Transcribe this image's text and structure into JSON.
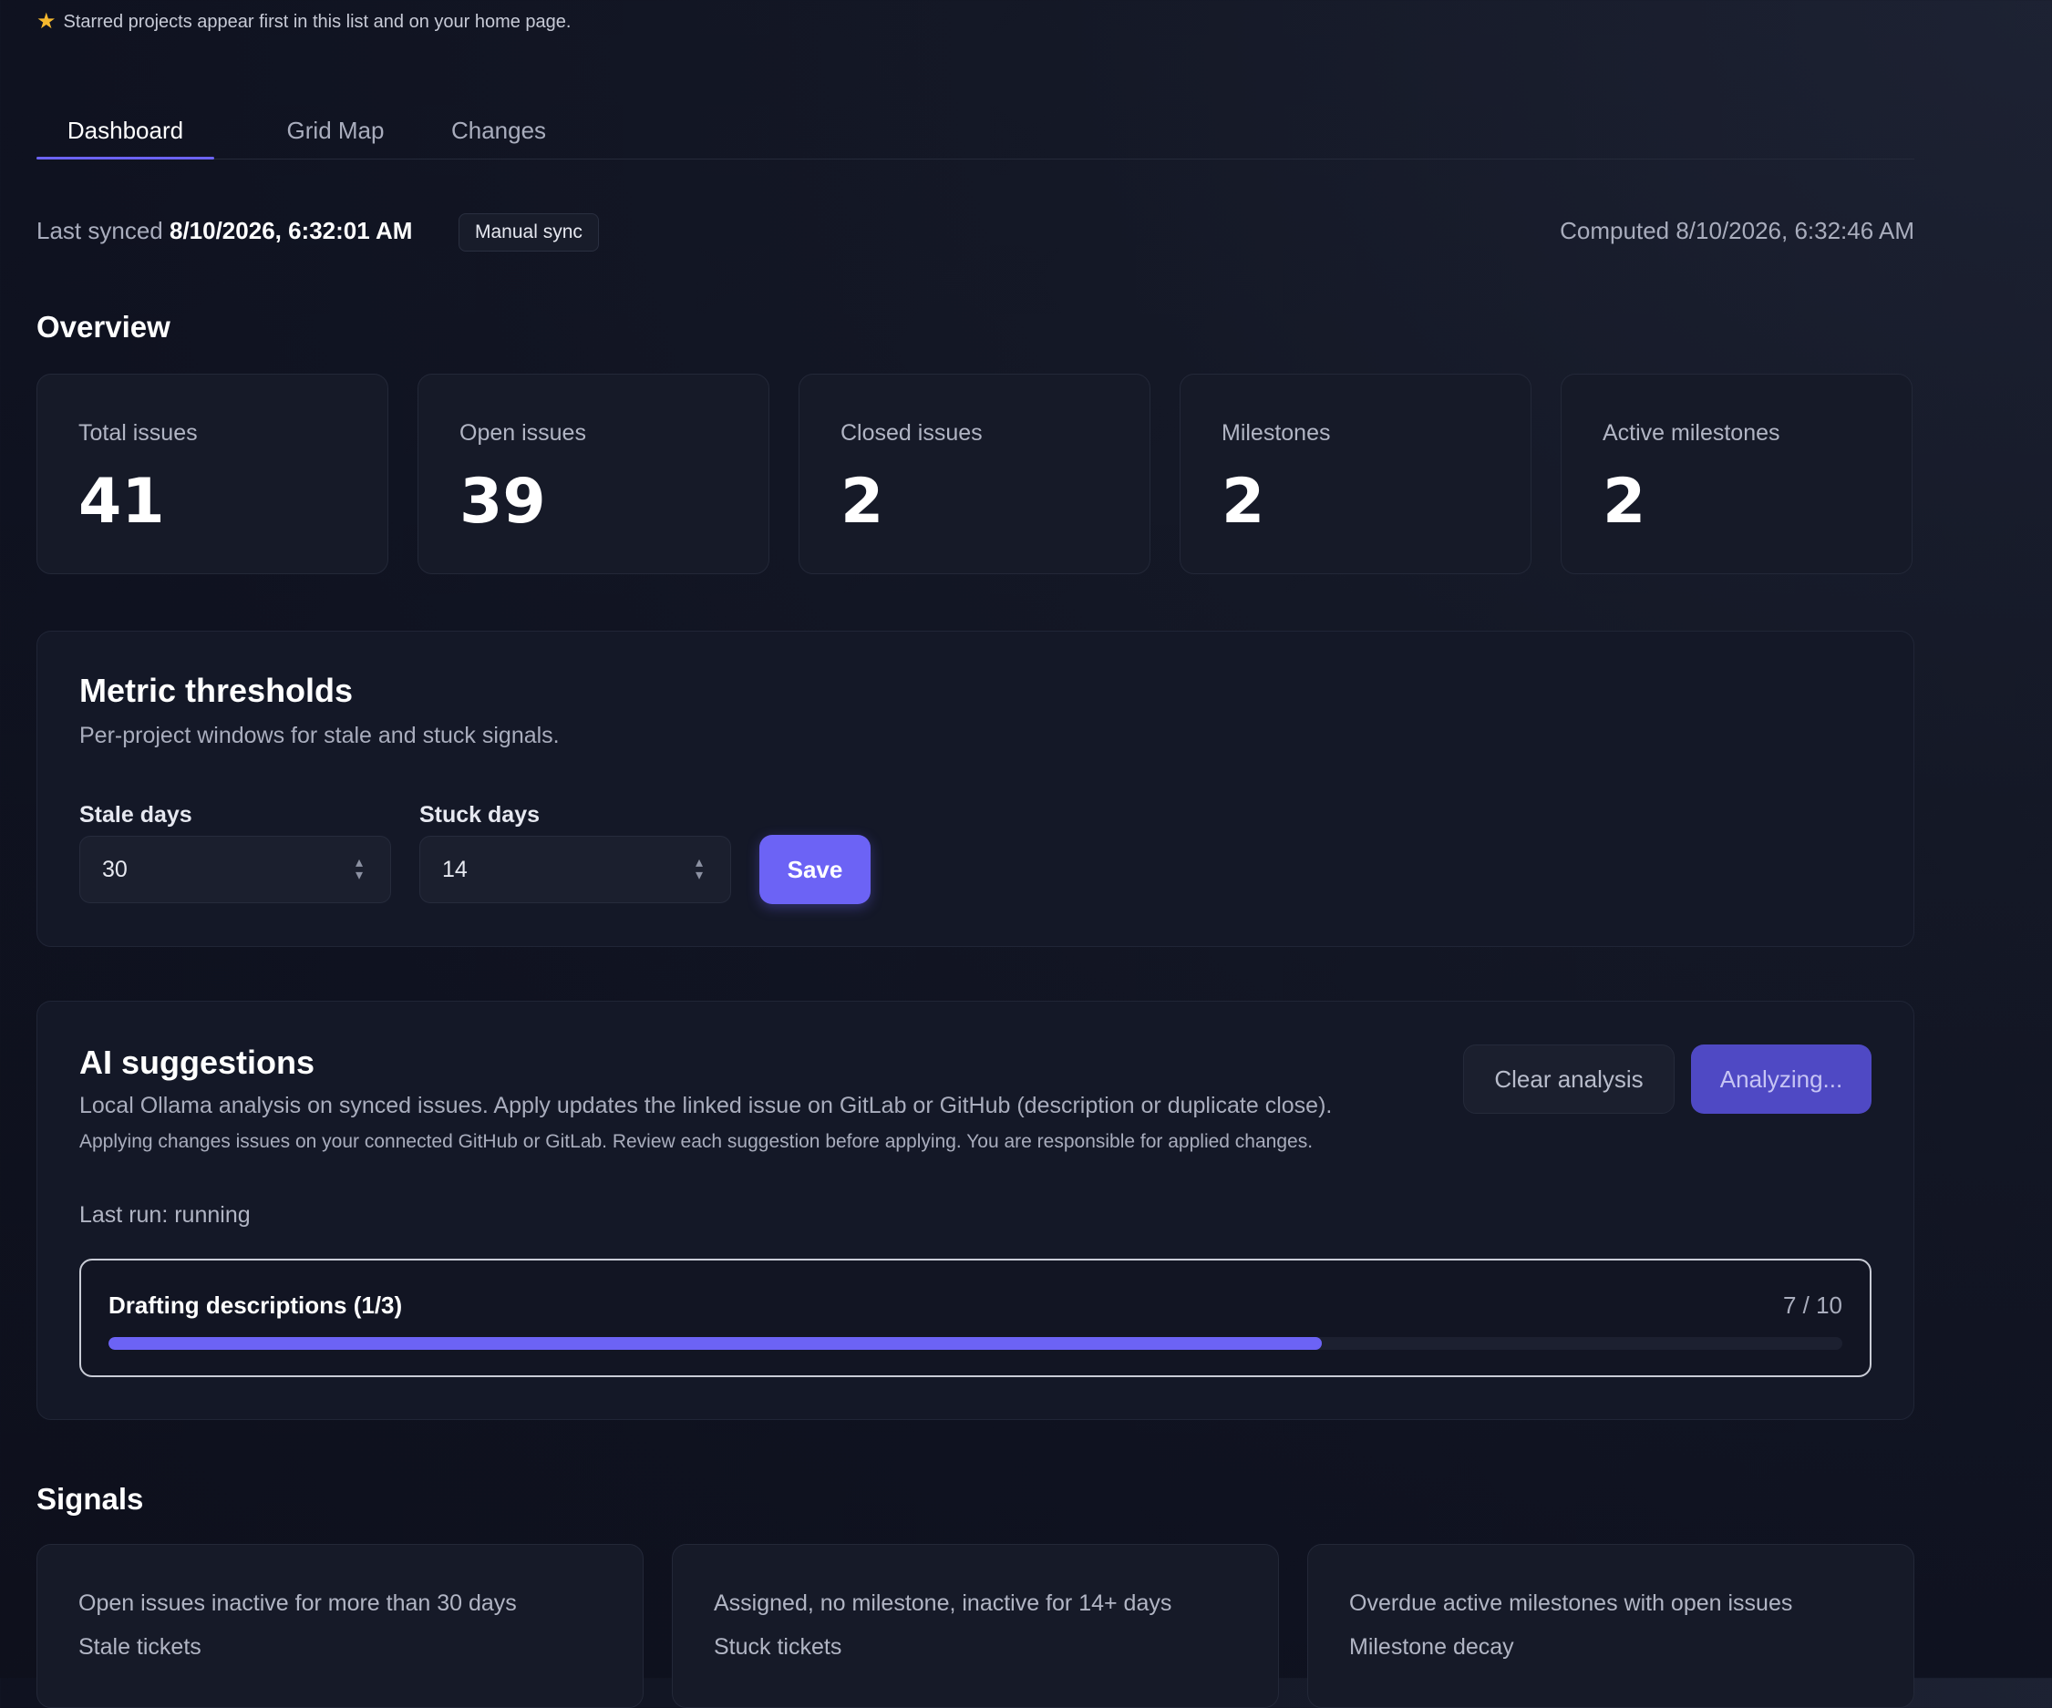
{
  "notice": {
    "text": "Starred projects appear first in this list and on your home page.",
    "icon": "star-icon"
  },
  "tabs": [
    {
      "label": "Dashboard",
      "active": true
    },
    {
      "label": "Grid Map",
      "active": false
    },
    {
      "label": "Changes",
      "active": false
    }
  ],
  "sync": {
    "last_synced_label": "Last synced",
    "last_synced_time": "8/10/2026, 6:32:01 AM",
    "manual_sync_label": "Manual sync",
    "computed_text": "Computed 8/10/2026, 6:32:46 AM"
  },
  "overview": {
    "title": "Overview",
    "stats": [
      {
        "label": "Total issues",
        "value": "41"
      },
      {
        "label": "Open issues",
        "value": "39"
      },
      {
        "label": "Closed issues",
        "value": "2"
      },
      {
        "label": "Milestones",
        "value": "2"
      },
      {
        "label": "Active milestones",
        "value": "2"
      }
    ]
  },
  "thresholds": {
    "title": "Metric thresholds",
    "subtitle": "Per-project windows for stale and stuck signals.",
    "stale_label": "Stale days",
    "stale_value": "30",
    "stuck_label": "Stuck days",
    "stuck_value": "14",
    "save_label": "Save"
  },
  "ai": {
    "title": "AI suggestions",
    "description": "Local Ollama analysis on synced issues. Apply updates the linked issue on GitLab or GitHub (description or duplicate close).",
    "warning": "Applying changes issues on your connected GitHub or GitLab. Review each suggestion before applying. You are responsible for applied changes.",
    "clear_label": "Clear analysis",
    "analyzing_label": "Analyzing...",
    "last_run": "Last run: running",
    "progress": {
      "label": "Drafting descriptions (1/3)",
      "count_text": "7 / 10",
      "fraction": 0.7
    }
  },
  "signals": {
    "title": "Signals",
    "cards": [
      {
        "description": "Open issues inactive for more than 30 days",
        "name": "Stale tickets"
      },
      {
        "description": "Assigned, no milestone, inactive for 14+ days",
        "name": "Stuck tickets"
      },
      {
        "description": "Overdue active milestones with open issues",
        "name": "Milestone decay"
      }
    ]
  },
  "colors": {
    "accent": "#6c63f5",
    "star": "#f5b82e",
    "background": "#0f1220"
  }
}
